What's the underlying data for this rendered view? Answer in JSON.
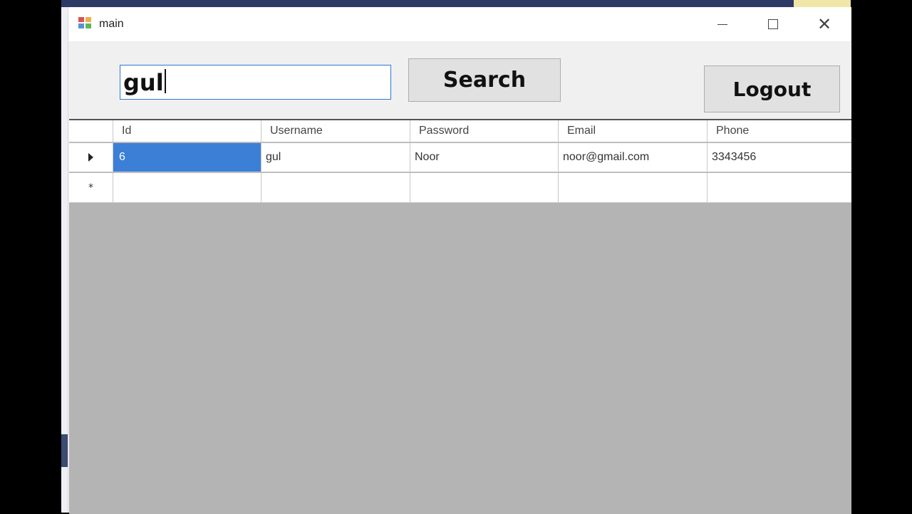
{
  "window": {
    "title": "main",
    "minimize_icon": "minimize-icon",
    "maximize_icon": "maximize-icon",
    "close_icon": "close-icon",
    "close_glyph": "✕"
  },
  "toolbar": {
    "search_value": "gul",
    "search_label": "Search",
    "logout_label": "Logout"
  },
  "grid": {
    "columns": [
      "Id",
      "Username",
      "Password",
      "Email",
      "Phone"
    ],
    "rows": [
      {
        "Id": "6",
        "Username": "gul",
        "Password": "Noor",
        "Email": "noor@gmail.com",
        "Phone": "3343456"
      }
    ],
    "new_row_marker": "*",
    "selection_color": "#3b7fd6"
  }
}
